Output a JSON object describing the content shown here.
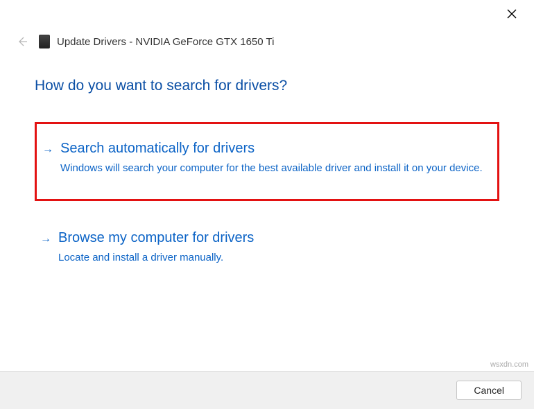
{
  "header": {
    "title": "Update Drivers - NVIDIA GeForce GTX 1650 Ti"
  },
  "question": "How do you want to search for drivers?",
  "options": [
    {
      "title": "Search automatically for drivers",
      "desc": "Windows will search your computer for the best available driver and install it on your device."
    },
    {
      "title": "Browse my computer for drivers",
      "desc": "Locate and install a driver manually."
    }
  ],
  "footer": {
    "cancel_label": "Cancel"
  },
  "watermark": "wsxdn.com"
}
